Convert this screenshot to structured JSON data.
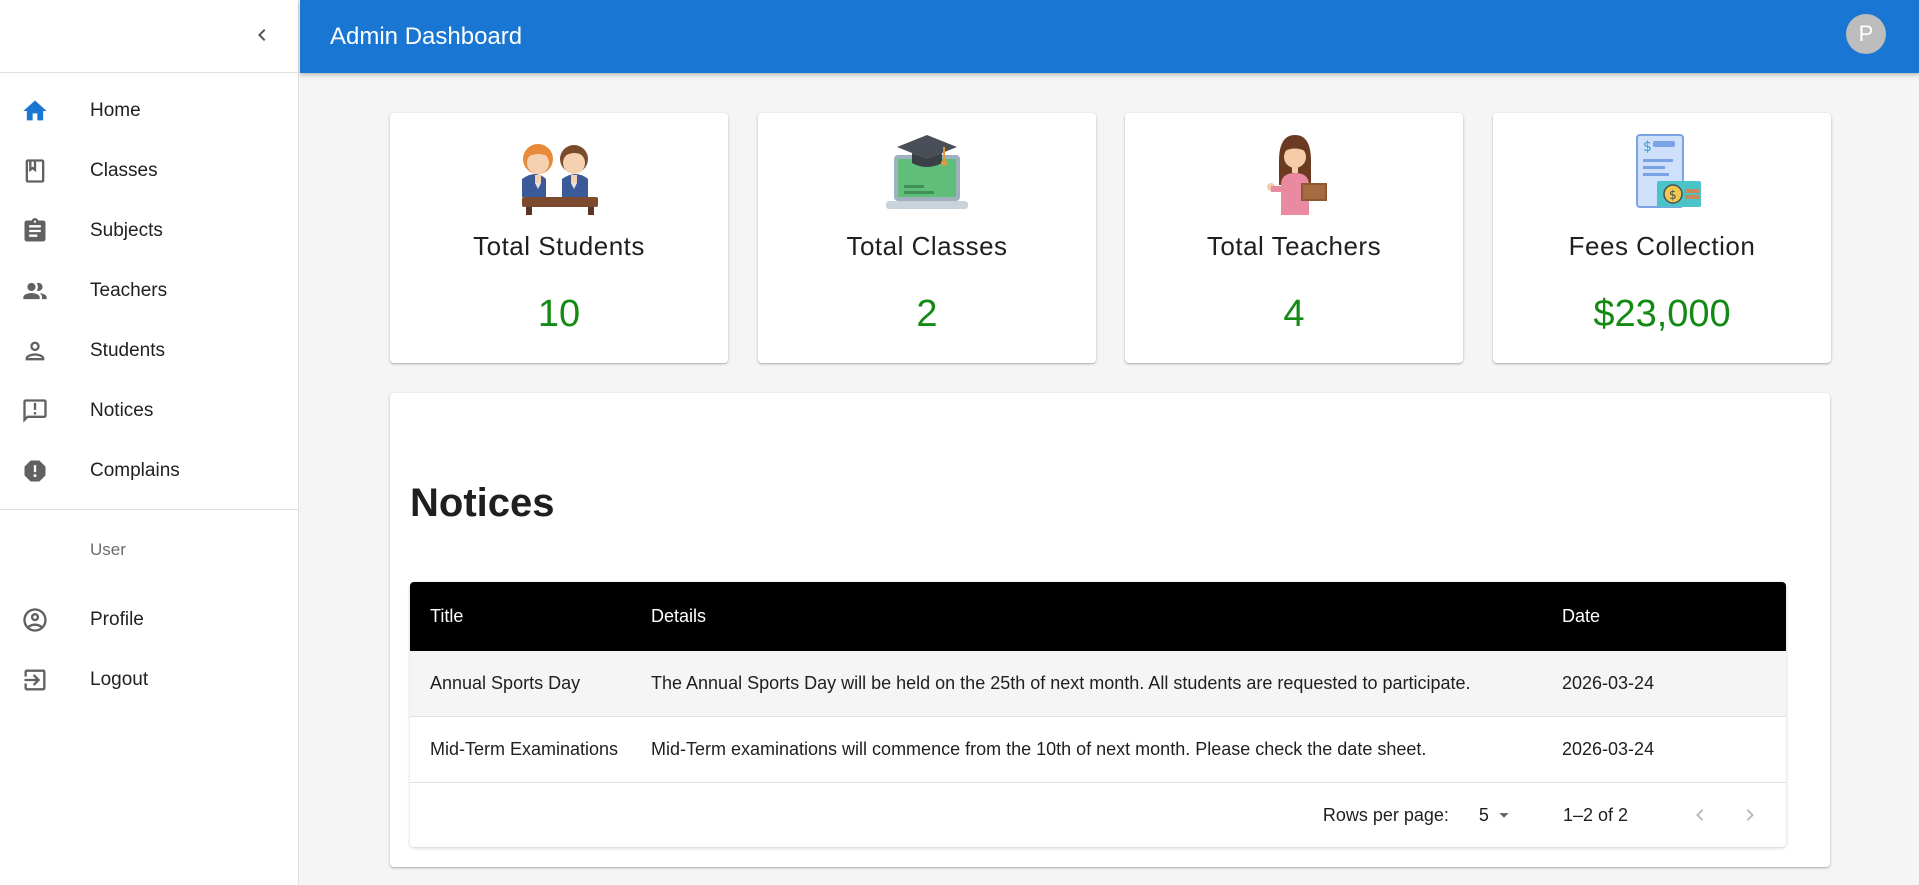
{
  "sidebar": {
    "items": [
      {
        "label": "Home",
        "icon": "home-icon"
      },
      {
        "label": "Classes",
        "icon": "book-icon"
      },
      {
        "label": "Subjects",
        "icon": "clipboard-icon"
      },
      {
        "label": "Teachers",
        "icon": "supervisor-icon"
      },
      {
        "label": "Students",
        "icon": "person-icon"
      },
      {
        "label": "Notices",
        "icon": "announcement-icon"
      },
      {
        "label": "Complains",
        "icon": "report-icon"
      }
    ],
    "user_header": "User",
    "user_items": [
      {
        "label": "Profile",
        "icon": "account-circle-icon"
      },
      {
        "label": "Logout",
        "icon": "logout-icon"
      }
    ],
    "active_color": "#1976d2"
  },
  "appbar": {
    "title": "Admin Dashboard",
    "avatar_initial": "P",
    "color": "#1976d2"
  },
  "stats": [
    {
      "title": "Total Students",
      "value": "10",
      "illustration": "students-illustration"
    },
    {
      "title": "Total Classes",
      "value": "2",
      "illustration": "graduation-laptop-illustration"
    },
    {
      "title": "Total Teachers",
      "value": "4",
      "illustration": "teacher-illustration"
    },
    {
      "title": "Fees Collection",
      "value": "$23,000",
      "illustration": "fees-illustration"
    }
  ],
  "notices": {
    "heading": "Notices",
    "columns": [
      "Title",
      "Details",
      "Date"
    ],
    "rows": [
      {
        "title": "Annual Sports Day",
        "details": "The Annual Sports Day will be held on the 25th of next month. All students are requested to participate.",
        "date": "2026-03-24"
      },
      {
        "title": "Mid-Term Examinations",
        "details": "Mid-Term examinations will commence from the 10th of next month. Please check the date sheet.",
        "date": "2026-03-24"
      }
    ],
    "pager": {
      "rows_per_page_label": "Rows per page:",
      "rows_per_page": "5",
      "range": "1–2 of 2"
    }
  },
  "colors": {
    "value_green": "#138a13",
    "header_black": "#000000"
  }
}
